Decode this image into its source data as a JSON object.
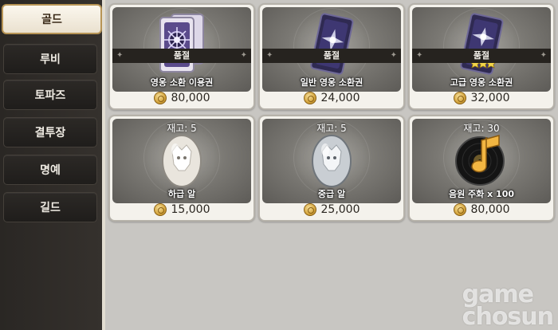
{
  "sidebar": {
    "tabs": [
      {
        "label": "골드",
        "active": true
      },
      {
        "label": "루비",
        "active": false
      },
      {
        "label": "토파즈",
        "active": false
      },
      {
        "label": "결투장",
        "active": false
      },
      {
        "label": "명예",
        "active": false
      },
      {
        "label": "길드",
        "active": false
      }
    ]
  },
  "shop": {
    "items": [
      {
        "name": "영웅 소환 이용권",
        "price": "80,000",
        "status": "품절",
        "icon": "hero-summon-ticket-icon"
      },
      {
        "name": "일반 영웅 소환권",
        "price": "24,000",
        "status": "품절",
        "icon": "normal-hero-summon-card-icon"
      },
      {
        "name": "고급 영웅 소환권",
        "price": "32,000",
        "status": "품절",
        "icon": "premium-hero-summon-card-icon"
      },
      {
        "name": "하급 알",
        "price": "15,000",
        "stock": "재고: 5",
        "icon": "low-grade-egg-icon"
      },
      {
        "name": "중급 알",
        "price": "25,000",
        "stock": "재고: 5",
        "icon": "mid-grade-egg-icon"
      },
      {
        "name": "음원 주화 x 100",
        "price": "80,000",
        "stock": "재고: 30",
        "icon": "music-coin-icon"
      }
    ]
  },
  "watermark": {
    "line1": "game",
    "line2": "chosun"
  },
  "colors": {
    "accent_border": "#b79455",
    "panel_bg": "#c8c6c2",
    "soldout_bar": "#26231f"
  }
}
